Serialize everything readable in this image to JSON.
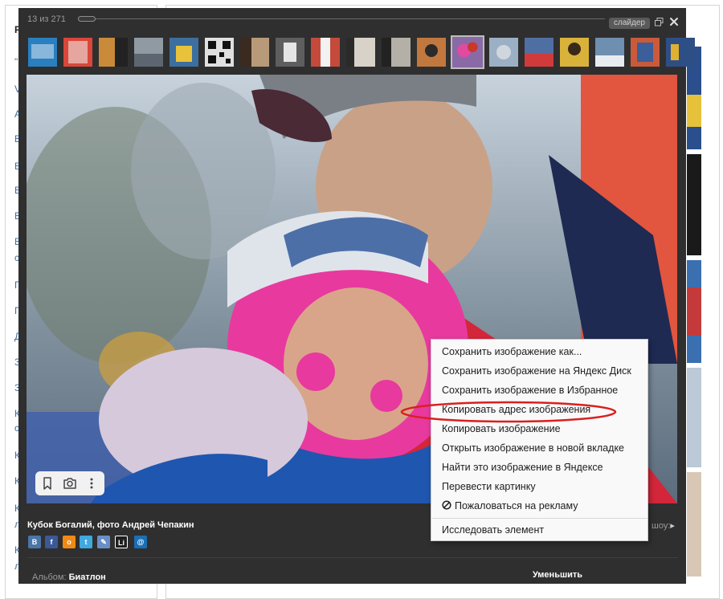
{
  "viewer": {
    "counter": "13 из 271",
    "slider_badge": "слайдер",
    "caption": "Кубок Богалий, фото Андрей Чепакин",
    "show_link": "шоу:",
    "album_label": "Альбом:",
    "album_name": "Биатлон",
    "shrink_label": "Уменьшить"
  },
  "background_letters": [
    "Р",
    "\"",
    "V",
    "А",
    "В",
    "В",
    "В",
    "В",
    "В",
    "с",
    "П",
    "П",
    "Д",
    "З",
    "З",
    "К",
    "с",
    "К",
    "К",
    "К",
    "л",
    "К",
    "л"
  ],
  "thumbnails": [
    {
      "name": "thumb-1",
      "color": "#2a7fc0"
    },
    {
      "name": "thumb-2",
      "color": "#d9473a"
    },
    {
      "name": "thumb-3",
      "color": "#c98b3a"
    },
    {
      "name": "thumb-4",
      "color": "#8f9aa3"
    },
    {
      "name": "thumb-5",
      "color": "#3c6e9f"
    },
    {
      "name": "thumb-6",
      "color": "#e0e0e0"
    },
    {
      "name": "thumb-7",
      "color": "#b89a7a"
    },
    {
      "name": "thumb-8",
      "color": "#5e5e5e"
    },
    {
      "name": "thumb-9",
      "color": "#c44a3c"
    },
    {
      "name": "thumb-10",
      "color": "#d8d2c8"
    },
    {
      "name": "thumb-11",
      "color": "#b5b0a7"
    },
    {
      "name": "thumb-12",
      "color": "#c0783f"
    },
    {
      "name": "thumb-13",
      "color": "#8a6aa6",
      "active": true
    },
    {
      "name": "thumb-14",
      "color": "#9bb0c4"
    },
    {
      "name": "thumb-15",
      "color": "#4f6fa3"
    },
    {
      "name": "thumb-16",
      "color": "#d9b23a"
    },
    {
      "name": "thumb-17",
      "color": "#6f8fb0"
    },
    {
      "name": "thumb-18",
      "color": "#c95a3a"
    },
    {
      "name": "thumb-19",
      "color": "#2e4f86"
    }
  ],
  "share": [
    {
      "name": "vk-share-icon",
      "glyph": "В",
      "color": "#4a76a8"
    },
    {
      "name": "facebook-share-icon",
      "glyph": "f",
      "color": "#3b5998"
    },
    {
      "name": "odnoklassniki-share-icon",
      "glyph": "о",
      "color": "#f08a16"
    },
    {
      "name": "twitter-share-icon",
      "glyph": "t",
      "color": "#3fa9e0"
    },
    {
      "name": "pencil-share-icon",
      "glyph": "✎",
      "color": "#6a8fc7"
    },
    {
      "name": "liveinternet-share-icon",
      "glyph": "Li",
      "color": "#1f1f1f"
    },
    {
      "name": "mail-share-icon",
      "glyph": "@",
      "color": "#1a6fb5"
    }
  ],
  "context_menu": {
    "items": [
      "Сохранить изображение как...",
      "Сохранить изображение на Яндекс Диск",
      "Сохранить изображение в Избранное",
      "Копировать адрес изображения",
      "Копировать изображение",
      "Открыть изображение в новой вкладке",
      "Найти это изображение в Яндексе",
      "Перевести картинку",
      "Пожаловаться на рекламу",
      "Исследовать элемент"
    ],
    "highlight_color": "#d9201f"
  }
}
